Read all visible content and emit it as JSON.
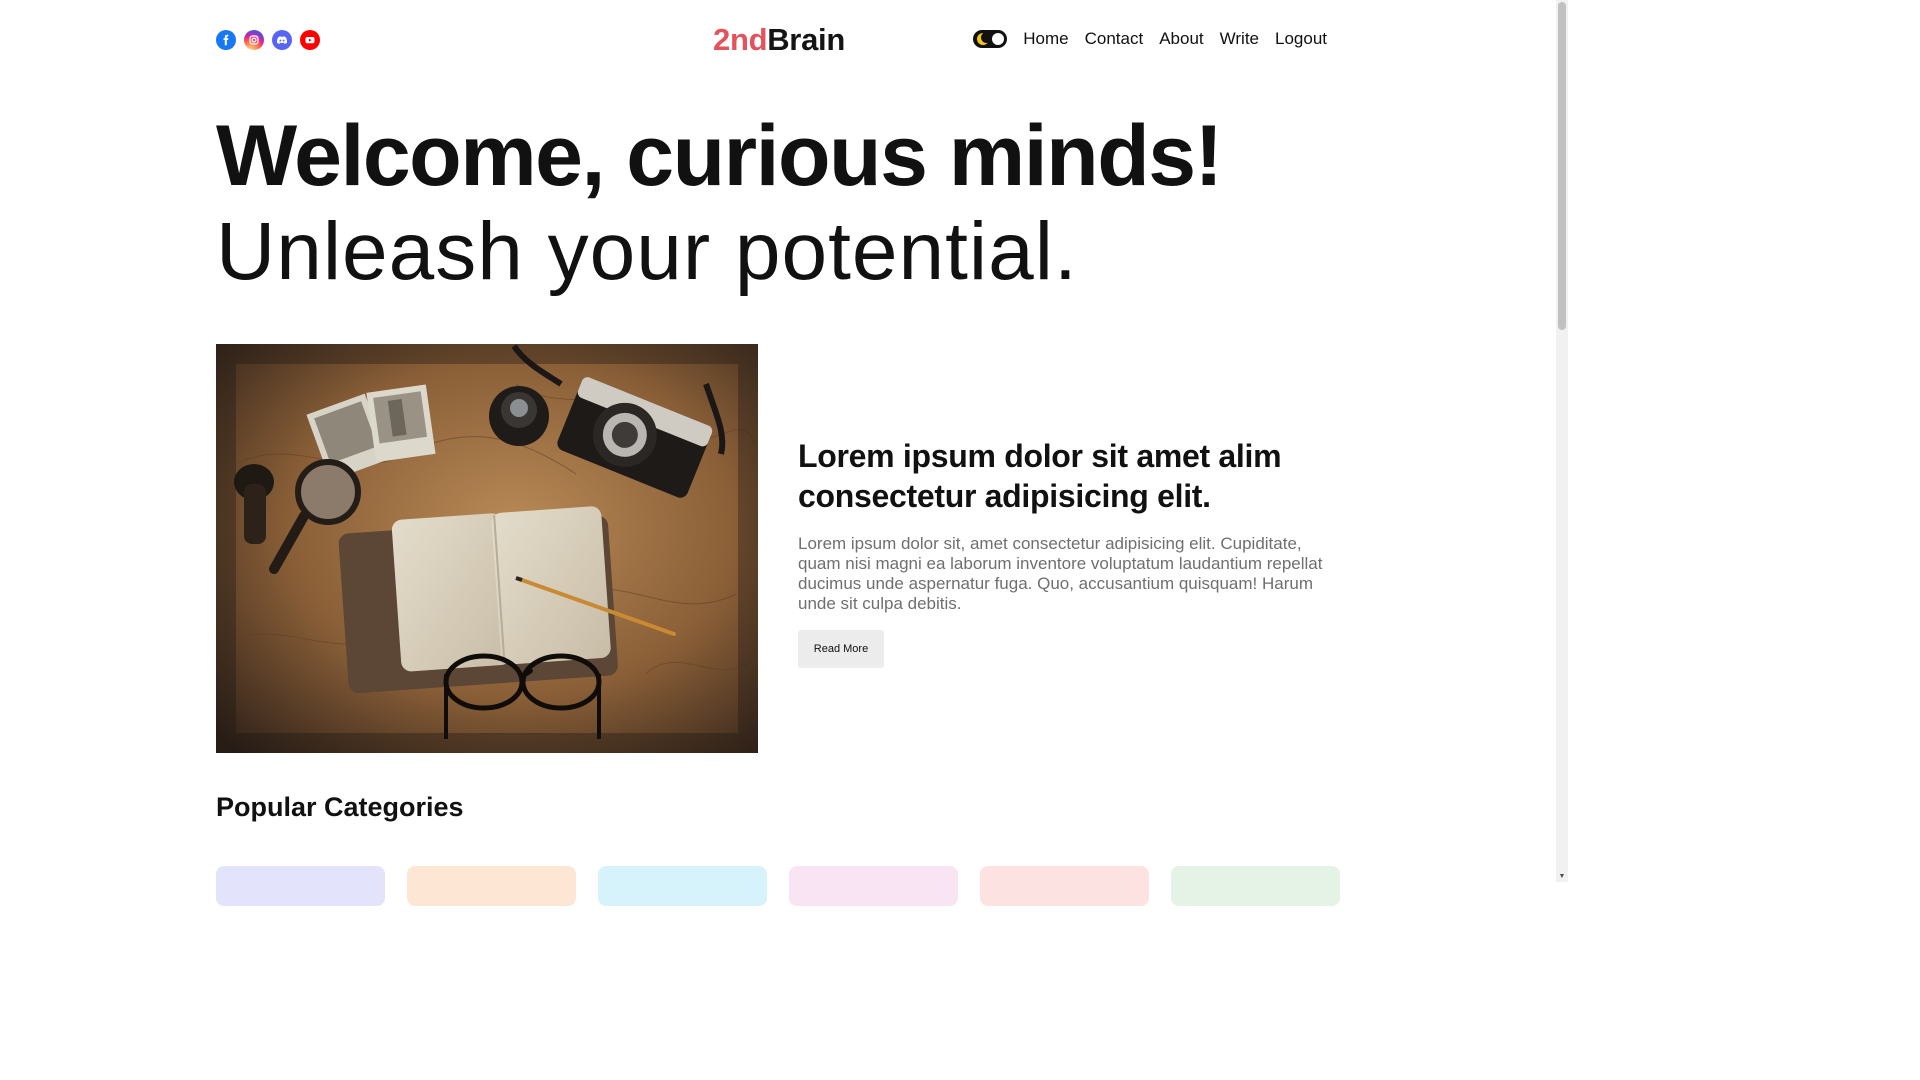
{
  "colors": {
    "logo_accent": "#e2535b",
    "text_primary": "#111111",
    "text_secondary": "#6f6f6f",
    "button_bg": "#ececec",
    "facebook": "#1877f2",
    "instagram": "#d62976",
    "discord": "#5865f2",
    "youtube": "#ff0000"
  },
  "header": {
    "socials": [
      {
        "icon": "facebook-icon"
      },
      {
        "icon": "instagram-icon"
      },
      {
        "icon": "discord-icon"
      },
      {
        "icon": "youtube-icon"
      }
    ],
    "logo_accent": "2nd",
    "logo_rest": "Brain",
    "theme_toggle_icon": "moon-icon",
    "nav": [
      {
        "label": "Home"
      },
      {
        "label": "Contact"
      },
      {
        "label": "About"
      },
      {
        "label": "Write"
      },
      {
        "label": "Logout"
      }
    ]
  },
  "hero": {
    "title": "Welcome, curious minds!",
    "subtitle": "Unleash your potential."
  },
  "featured_post": {
    "image_icon": "travel-desk-photo",
    "title": "Lorem ipsum dolor sit amet alim consectetur adipisicing elit.",
    "description": "Lorem ipsum dolor sit, amet consectetur adipisicing elit. Cupiditate, quam nisi magni ea laborum inventore voluptatum laudantium repellat ducimus unde aspernatur fuga. Quo, accusantium quisquam! Harum unde sit culpa debitis.",
    "button_label": "Read More"
  },
  "categories_section": {
    "title": "Popular Categories",
    "categories": [
      {
        "color": "#e3e3fc"
      },
      {
        "color": "#fde6d4"
      },
      {
        "color": "#d6f3fb"
      },
      {
        "color": "#f8e4f2"
      },
      {
        "color": "#fde2e2"
      },
      {
        "color": "#e4f3e6"
      }
    ]
  }
}
